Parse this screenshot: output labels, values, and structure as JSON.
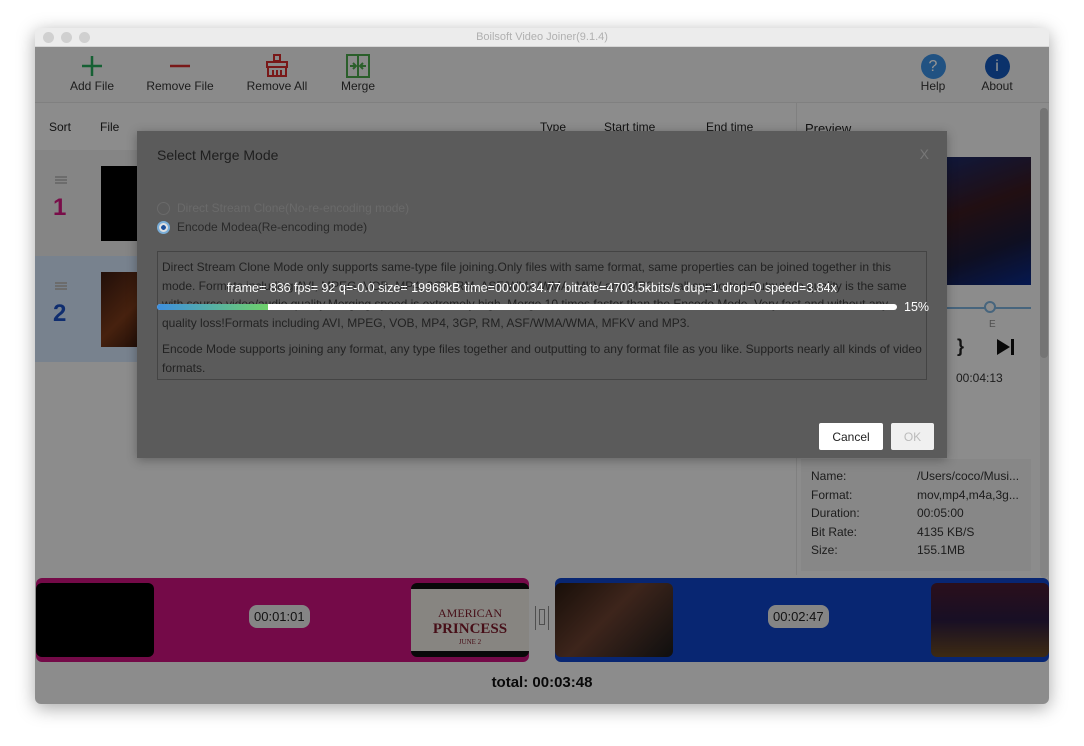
{
  "window": {
    "title": "Boilsoft Video Joiner(9.1.4)"
  },
  "toolbar": {
    "add_file": "Add File",
    "remove_file": "Remove File",
    "remove_all": "Remove All",
    "merge": "Merge",
    "help": "Help",
    "about": "About"
  },
  "list": {
    "headers": {
      "sort": "Sort",
      "file": "File",
      "type": "Type",
      "start": "Start time",
      "end": "End time"
    },
    "rows": [
      {
        "num": "1",
        "color": "#d0187f"
      },
      {
        "num": "2",
        "color": "#1a4fc0"
      }
    ]
  },
  "preview": {
    "label": "Preview",
    "end_marker": "E",
    "bracket": "}",
    "time": "00:04:13",
    "info": [
      {
        "k": "Name:",
        "v": "/Users/coco/Musi..."
      },
      {
        "k": "Format:",
        "v": "mov,mp4,m4a,3g..."
      },
      {
        "k": "Duration:",
        "v": "00:05:00"
      },
      {
        "k": "Bit Rate:",
        "v": "4135 KB/S"
      },
      {
        "k": "Size:",
        "v": "155.1MB"
      }
    ]
  },
  "timeline": {
    "clips": [
      {
        "duration": "00:01:01",
        "color": "#c8127d"
      },
      {
        "duration": "00:02:47",
        "color": "#0f43c4"
      }
    ],
    "poster": {
      "l1": "AMERICAN",
      "l2": "PRINCESS",
      "l3": "JUNE 2"
    },
    "total": "total: 00:03:48"
  },
  "dialog": {
    "title": "Select Merge Mode",
    "close": "X",
    "option_direct": "Direct Stream Clone(No-re-encoding mode)",
    "option_encode": "Encode Modea(Re-encoding mode)",
    "selected": "encode",
    "desc1": "Direct Stream Clone Mode only supports same-type file joining.Only files with same format, same properties can be joined together in this mode. Formats including AVI, MPEG, VOB, MP4, 3GP, RM, ASF/WMA/WMA, MKV and MP3 are all supported.Output file quality is the same with source video/audio quality.Merging speed is extremely high. Merge 10 times faster than the Encode Mode. Very fast and without any quality loss!Formats including AVI, MPEG, VOB, MP4, 3GP, RM, ASF/WMA/WMA, MFKV and MP3.",
    "desc2": "Encode Mode supports joining any format, any type files together and outputting to any format file as you like. Supports nearly all kinds of video formats.",
    "progress_text": "frame= 836 fps= 92 q=-0.0 size= 19968kB time=00:00:34.77 bitrate=4703.5kbits/s dup=1 drop=0 speed=3.84x",
    "progress_percent": 15,
    "progress_label": "15%",
    "cancel": "Cancel",
    "ok": "OK"
  },
  "colors": {
    "help": "#3a8ee0",
    "about": "#1357b8",
    "add": "#27a65a",
    "remove": "#d02a2a",
    "merge": "#4aa44a"
  }
}
